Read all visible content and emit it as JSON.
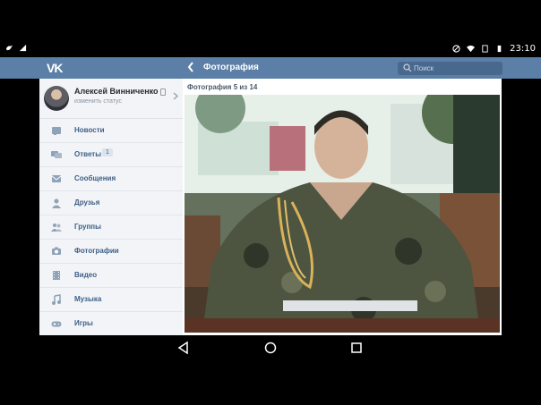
{
  "status_bar": {
    "time": "23:10"
  },
  "header": {
    "logo_text": "VK",
    "title": "Фотография",
    "search": {
      "placeholder": "Поиск",
      "value": ""
    }
  },
  "profile": {
    "name": "Алексей Винниченко",
    "status_link": "изменить статус"
  },
  "menu": {
    "items": [
      {
        "label": "Новости",
        "icon": "news-icon"
      },
      {
        "label": "Ответы",
        "icon": "replies-icon",
        "badge": "1"
      },
      {
        "label": "Сообщения",
        "icon": "messages-icon"
      },
      {
        "label": "Друзья",
        "icon": "friends-icon"
      },
      {
        "label": "Группы",
        "icon": "groups-icon"
      },
      {
        "label": "Фотографии",
        "icon": "camera-icon"
      },
      {
        "label": "Видео",
        "icon": "video-icon"
      },
      {
        "label": "Музыка",
        "icon": "music-icon"
      },
      {
        "label": "Игры",
        "icon": "gamepad-icon"
      }
    ]
  },
  "photo": {
    "counter": "Фотография 5 из 14",
    "subject": "portrait-photo"
  },
  "colors": {
    "header": "#5b7fa6",
    "search_bg": "#49688d",
    "menu_text": "#3d5f86",
    "sidebar_bg": "#f2f4f7"
  }
}
